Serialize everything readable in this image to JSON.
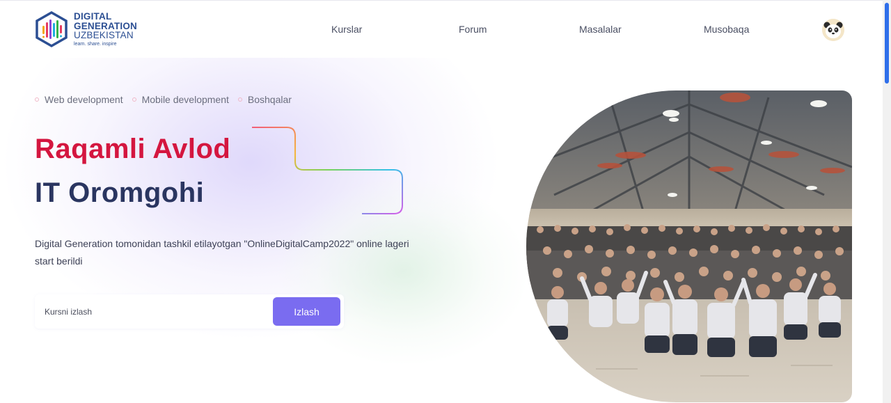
{
  "brand": {
    "line1": "DIGITAL",
    "line2": "GENERATION",
    "line3": "UZBEKISTAN",
    "tagline": "learn. share. inspire"
  },
  "nav": {
    "items": [
      "Kurslar",
      "Forum",
      "Masalalar",
      "Musobaqa"
    ]
  },
  "hero": {
    "categories": [
      "Web development",
      "Mobile development",
      "Boshqalar"
    ],
    "title_line1": "Raqamli Avlod",
    "title_line2": "IT Oromgohi",
    "description": "Digital Generation tomonidan tashkil etilayotgan \"OnlineDigitalCamp2022\" online lageri start berildi"
  },
  "search": {
    "placeholder": "Kursni izlash",
    "button_label": "Izlash"
  },
  "icons": {
    "logo": "hexagon-logo-icon",
    "avatar": "panda-avatar-icon"
  },
  "colors": {
    "title_red": "#d4163f",
    "title_navy": "#2a3560",
    "button": "#7a6cf0",
    "brand_blue": "#2c4f93",
    "scroll_thumb": "#2f6fea"
  }
}
